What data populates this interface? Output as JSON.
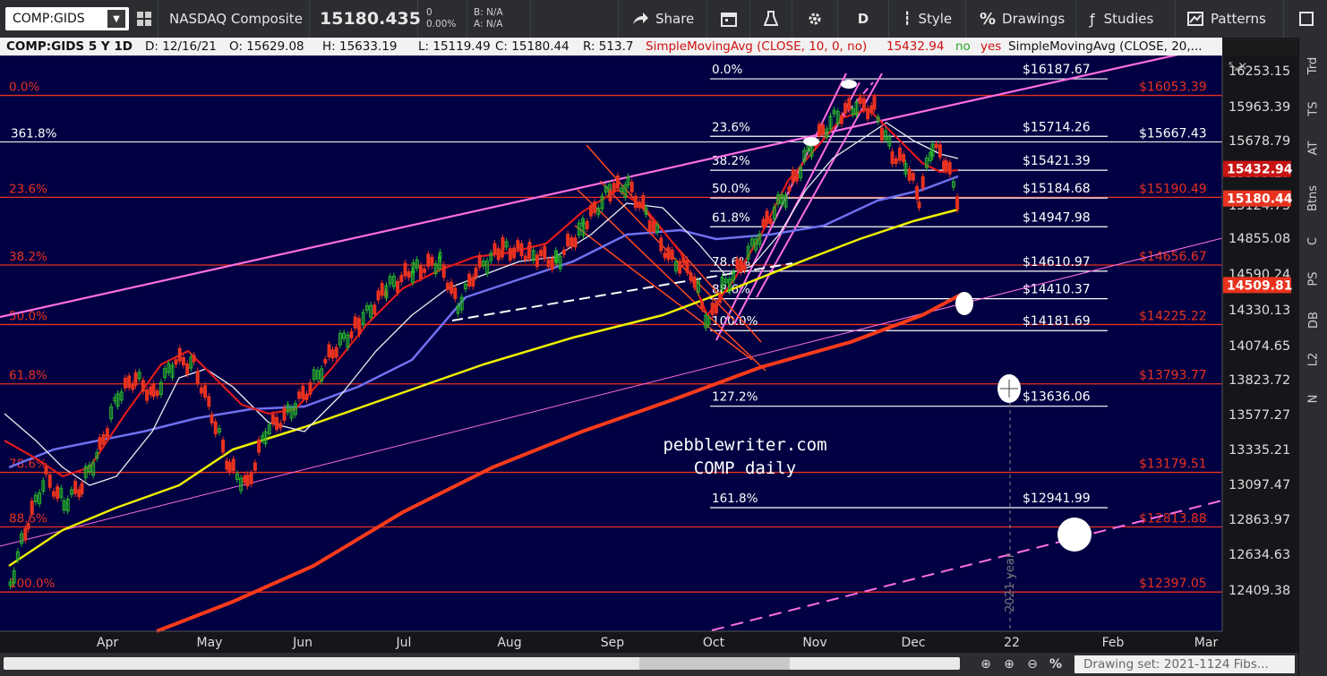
{
  "toolbar": {
    "symbol": "COMP:GIDS",
    "name": "NASDAQ Composite",
    "price": "15180.435",
    "change": "0",
    "change_pct": "0.00%",
    "bid": "B: N/A",
    "ask": "A: N/A",
    "share_label": "Share",
    "period_label": "D",
    "style_label": "Style",
    "drawings_label": "Drawings",
    "studies_label": "Studies",
    "patterns_label": "Patterns"
  },
  "infobar": {
    "title": "COMP:GIDS 5 Y 1D",
    "date": "D: 12/16/21",
    "open": "O: 15629.08",
    "high": "H: 15633.19",
    "low": "L: 15119.49",
    "close": "C: 15180.44",
    "range": "R: 513.7",
    "sma1": "SimpleMovingAvg (CLOSE, 10, 0, no)",
    "sma1_value": "15432.94",
    "no_label": "no",
    "yes_label": "yes",
    "sma2": "SimpleMovingAvg (CLOSE, 20,..."
  },
  "sidebar": {
    "items": [
      "Trd",
      "TS",
      "AT",
      "Btns",
      "C",
      "PS",
      "DB",
      "L2",
      "N"
    ]
  },
  "bottombar": {
    "drawing_set": "Drawing set: 2021-1124 Fibs..."
  },
  "colors": {
    "background": "#000042",
    "fib_red": "#e8321e",
    "fib_white": "#ffffff",
    "pink": "#ff6ee0",
    "sma10": "#e01a1a",
    "sma20": "#f0f0f0",
    "sma50": "#7070f0",
    "sma100": "#f0f000",
    "sma200": "#ff3b1a",
    "up_candle": "#28b428",
    "down_candle": "#e8321e"
  },
  "chart_data": {
    "type": "candlestick",
    "symbol": "COMP:GIDS",
    "timeframe": "5 Y 1D",
    "y_axis": {
      "ticks": [
        "16253.15",
        "15963.39",
        "15678.79",
        "15399.27",
        "15124.75",
        "14855.08",
        "14590.24",
        "14330.13",
        "14074.65",
        "13823.72",
        "13577.27",
        "13335.21",
        "13097.47",
        "12863.97",
        "12634.63",
        "12409.38"
      ],
      "ylim": [
        12330,
        16380
      ]
    },
    "x_axis": {
      "labels": [
        "Apr",
        "May",
        "Jun",
        "Jul",
        "Aug",
        "Sep",
        "Oct",
        "Nov",
        "Dec",
        "22",
        "Feb",
        "Mar"
      ]
    },
    "price_tags": [
      {
        "label": "15432.94",
        "value": 15432.94,
        "color": "#c81414"
      },
      {
        "label": "15180.44",
        "value": 15180.44,
        "color": "#e8321e"
      },
      {
        "label": "14509.81",
        "value": 14509.81,
        "color": "#e8321e"
      }
    ],
    "fib_red": [
      {
        "pct": "0.0%",
        "price": "$16053.39",
        "value": 16053.39
      },
      {
        "pct": "23.6%",
        "price": "$15190.49",
        "value": 15190.49
      },
      {
        "pct": "38.2%",
        "price": "$14656.67",
        "value": 14656.67
      },
      {
        "pct": "50.0%",
        "price": "$14225.22",
        "value": 14225.22
      },
      {
        "pct": "61.8%",
        "price": "$13793.77",
        "value": 13793.77
      },
      {
        "pct": "78.6%",
        "price": "$13179.51",
        "value": 13179.51
      },
      {
        "pct": "88.6%",
        "price": "$12813.88",
        "value": 12813.88
      },
      {
        "pct": "100.0%",
        "price": "$12397.05",
        "value": 12397.05
      }
    ],
    "fib_white": [
      {
        "pct": "0.0%",
        "price": "$16187.67",
        "value": 16187.67
      },
      {
        "pct": "23.6%",
        "price": "$15714.26",
        "value": 15714.26
      },
      {
        "pct": "38.2%",
        "price": "$15421.39",
        "value": 15421.39
      },
      {
        "pct": "50.0%",
        "price": "$15184.68",
        "value": 15184.68
      },
      {
        "pct": "61.8%",
        "price": "$14947.98",
        "value": 14947.98
      },
      {
        "pct": "78.6%",
        "price": "$14610.97",
        "value": 14610.97
      },
      {
        "pct": "88.6%",
        "price": "$14410.37",
        "value": 14410.37
      },
      {
        "pct": "100.0%",
        "price": "$14181.69",
        "value": 14181.69
      },
      {
        "pct": "127.2%",
        "price": "$13636.06",
        "value": 13636.06
      },
      {
        "pct": "161.8%",
        "price": "$12941.99",
        "value": 12941.99
      }
    ],
    "extension_line": {
      "pct": "361.8%",
      "price": "$15667.43",
      "value": 15667.43
    },
    "watermark": [
      "pebblewriter.com",
      "COMP daily"
    ],
    "year_marker": "2021 year",
    "series": [
      {
        "name": "SMA 10",
        "color": "#e01a1a"
      },
      {
        "name": "SMA 20",
        "color": "#f0f0f0"
      },
      {
        "name": "SMA 50",
        "color": "#7070f0"
      },
      {
        "name": "SMA 100",
        "color": "#f0f000"
      },
      {
        "name": "SMA 200",
        "color": "#ff3b1a"
      }
    ],
    "grid": false
  }
}
